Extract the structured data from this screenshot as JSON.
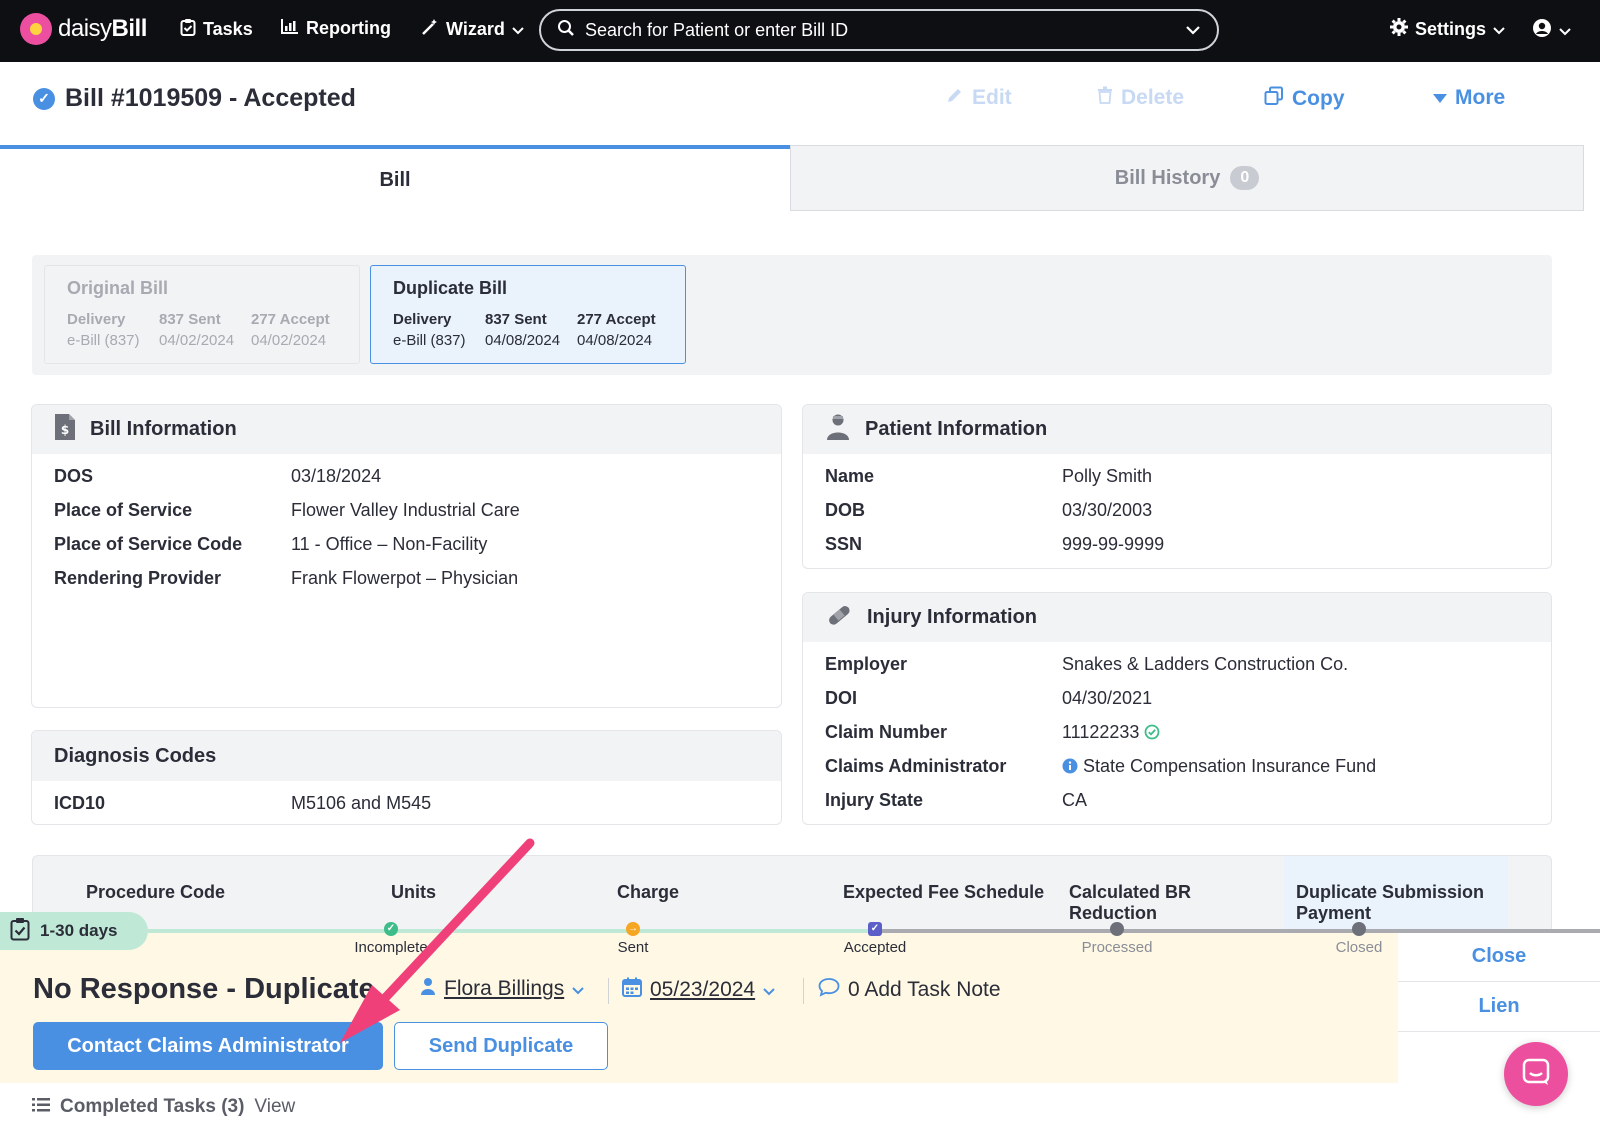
{
  "app": {
    "brand_prefix": "daisy",
    "brand_suffix": "Bill",
    "nav": {
      "tasks": "Tasks",
      "reporting": "Reporting",
      "wizard": "Wizard",
      "settings": "Settings"
    },
    "search_placeholder": "Search for Patient or enter Bill ID"
  },
  "header": {
    "title": "Bill #1019509 - Accepted",
    "actions": {
      "edit": "Edit",
      "delete": "Delete",
      "copy": "Copy",
      "more": "More"
    }
  },
  "tabs": {
    "bill": "Bill",
    "history": "Bill History",
    "history_count": "0"
  },
  "bills": {
    "original": {
      "title": "Original Bill",
      "h1": "Delivery",
      "h2": "837 Sent",
      "h3": "277 Accept",
      "v1": "e-Bill (837)",
      "v2": "04/02/2024",
      "v3": "04/02/2024"
    },
    "duplicate": {
      "title": "Duplicate Bill",
      "h1": "Delivery",
      "h2": "837 Sent",
      "h3": "277 Accept",
      "v1": "e-Bill (837)",
      "v2": "04/08/2024",
      "v3": "04/08/2024"
    }
  },
  "bill_info": {
    "title": "Bill Information",
    "rows": [
      {
        "label": "DOS",
        "value": "03/18/2024"
      },
      {
        "label": "Place of Service",
        "value": "Flower Valley Industrial Care"
      },
      {
        "label": "Place of Service Code",
        "value": "11 - Office – Non-Facility"
      },
      {
        "label": "Rendering Provider",
        "value": "Frank Flowerpot – Physician"
      }
    ]
  },
  "patient_info": {
    "title": "Patient Information",
    "rows": [
      {
        "label": "Name",
        "value": "Polly Smith"
      },
      {
        "label": "DOB",
        "value": "03/30/2003"
      },
      {
        "label": "SSN",
        "value": "999-99-9999"
      }
    ]
  },
  "injury_info": {
    "title": "Injury Information",
    "rows": [
      {
        "label": "Employer",
        "value": "Snakes & Ladders Construction Co."
      },
      {
        "label": "DOI",
        "value": "04/30/2021"
      },
      {
        "label": "Claim Number",
        "value": "11122233"
      },
      {
        "label": "Claims Administrator",
        "value": "State Compensation Insurance Fund"
      },
      {
        "label": "Injury State",
        "value": "CA"
      }
    ]
  },
  "diagnosis": {
    "title": "Diagnosis Codes",
    "label": "ICD10",
    "value": "M5106 and M545"
  },
  "procedure_headers": {
    "code": "Procedure Code",
    "units": "Units",
    "charge": "Charge",
    "fee": "Expected Fee Schedule",
    "br": "Calculated BR Reduction",
    "dup": "Duplicate Submission Payment"
  },
  "task": {
    "age_badge": "1-30 days",
    "steps": [
      "Incomplete",
      "Sent",
      "Accepted",
      "Processed",
      "Closed"
    ],
    "title": "No Response - Duplicate",
    "assignee": "Flora Billings",
    "due_date": "05/23/2024",
    "note": "0 Add Task Note",
    "primary_button": "Contact Claims Administrator",
    "secondary_button": "Send Duplicate",
    "side_links": [
      "Close",
      "Lien"
    ],
    "completed_label": "Completed Tasks (3)",
    "completed_view": "View"
  },
  "colors": {
    "accent": "#4a90e2",
    "topbar": "#0e0f13",
    "task_bg": "#fef8e5",
    "age_badge": "#bfe9d6",
    "arrow": "#f0407a"
  }
}
